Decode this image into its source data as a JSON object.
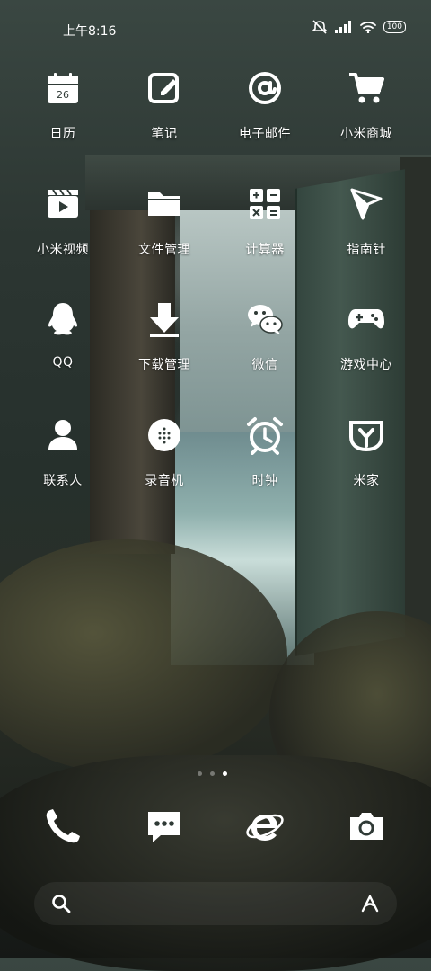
{
  "status_bar": {
    "time": "上午8:16",
    "battery": "100"
  },
  "apps": [
    {
      "label": "日历",
      "calendar_day": "26"
    },
    {
      "label": "笔记"
    },
    {
      "label": "电子邮件"
    },
    {
      "label": "小米商城"
    },
    {
      "label": "小米视频"
    },
    {
      "label": "文件管理"
    },
    {
      "label": "计算器"
    },
    {
      "label": "指南针"
    },
    {
      "label": "QQ"
    },
    {
      "label": "下载管理"
    },
    {
      "label": "微信"
    },
    {
      "label": "游戏中心"
    },
    {
      "label": "联系人"
    },
    {
      "label": "录音机"
    },
    {
      "label": "时钟"
    },
    {
      "label": "米家"
    }
  ],
  "page_indicator": {
    "count": 3,
    "active": 3
  },
  "dock": [
    "phone-icon",
    "messages-icon",
    "browser-icon",
    "camera-icon"
  ],
  "search_bar": {
    "left_icon": "search-icon",
    "right_icon": "assistant-icon"
  }
}
